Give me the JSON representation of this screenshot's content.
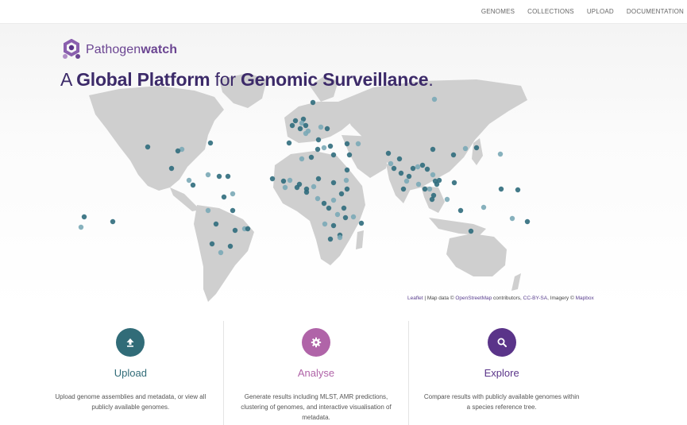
{
  "nav": {
    "items": [
      {
        "label": "GENOMES"
      },
      {
        "label": "COLLECTIONS"
      },
      {
        "label": "UPLOAD"
      },
      {
        "label": "DOCUMENTATION"
      }
    ]
  },
  "brand": {
    "prefix": "Pathogen",
    "suffix": "watch",
    "logo_icon": "hex-cluster-logo-icon"
  },
  "tagline": {
    "w1": "A",
    "w2": "Global Platform",
    "w3": "for",
    "w4": "Genomic Surveillance",
    "w5": "."
  },
  "map": {
    "land_color": "#cfcfcf",
    "marker_dark": "#2f6b7c",
    "marker_light": "#7aa9b6"
  },
  "attribution": {
    "leaflet": "Leaflet",
    "sep1": " | Map data © ",
    "osm": "OpenStreetMap",
    "contrib": " contributors, ",
    "license": "CC-BY-SA",
    "imagery": ", Imagery © ",
    "mapbox": "Mapbox"
  },
  "features": [
    {
      "title": "Upload",
      "icon": "upload-icon",
      "color": "#316c78",
      "description": "Upload genome assemblies and metadata, or view all publicly available genomes."
    },
    {
      "title": "Analyse",
      "icon": "gear-icon",
      "color": "#b064a8",
      "description": "Generate results including MLST, AMR predictions, clustering of genomes, and interactive visualisation of metadata."
    },
    {
      "title": "Explore",
      "icon": "search-icon",
      "color": "#5a3489",
      "description": "Compare results with publicly available genomes within a species reference tree."
    }
  ]
}
